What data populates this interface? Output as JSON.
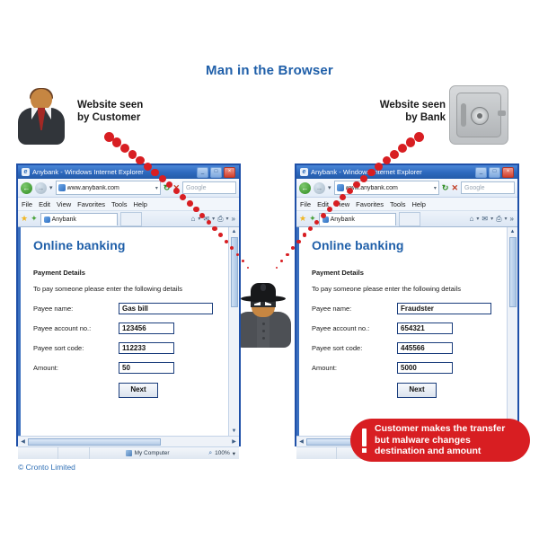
{
  "title": "Man in the Browser",
  "captions": {
    "customer": "Website seen\nby Customer",
    "customer_line1": "Website seen",
    "customer_line2": "by Customer",
    "bank_line1": "Website seen",
    "bank_line2": "by Bank"
  },
  "icons": {
    "customer": "customer-avatar-icon",
    "bank": "bank-safe-icon",
    "hacker": "hacker-icon"
  },
  "browser_chrome": {
    "window_title": "Anybank - Windows Internet Explorer",
    "minimize_label": "_",
    "maximize_label": "□",
    "close_label": "×",
    "back_label": "←",
    "forward_label": "→",
    "history_caret": "▾",
    "address": "www.anybank.com",
    "address_caret": "▾",
    "refresh_label": "↻",
    "stop_label": "✕",
    "search_placeholder": "Google",
    "menu": [
      "File",
      "Edit",
      "View",
      "Favorites",
      "Tools",
      "Help"
    ],
    "favorites_star": "★",
    "favorites_add": "✦",
    "tab_label": "Anybank",
    "toolbar_icons": [
      "⌂",
      "✉",
      "⎙"
    ],
    "toolbar_caret": "▾",
    "toolbar_chevron": "»",
    "scroll_up": "▲",
    "scroll_down": "▼",
    "scroll_left": "◀",
    "scroll_right": "▶",
    "status_zone": "My Computer",
    "status_zoom": "100%",
    "status_zoom_caret": "▾",
    "status_magnifier": "⌕"
  },
  "page": {
    "heading": "Online banking",
    "subheading": "Payment Details",
    "lead": "To pay someone please enter the following details",
    "labels": {
      "payee_name": "Payee name:",
      "payee_account": "Payee account no.:",
      "payee_sort": "Payee sort code:",
      "amount": "Amount:"
    },
    "next_button": "Next"
  },
  "customer_view": {
    "payee_name": "Gas bill",
    "payee_account": "123456",
    "payee_sort": "112233",
    "amount": "50"
  },
  "bank_view": {
    "payee_name": "Fraudster",
    "payee_account": "654321",
    "payee_sort": "445566",
    "amount": "5000"
  },
  "callout": {
    "line1": "Customer makes the transfer",
    "line2": "but malware changes",
    "line3": "destination and amount"
  },
  "footer": "© Cronto Limited",
  "colors": {
    "title_blue": "#1f5fa9",
    "accent_red": "#d81e22",
    "window_border": "#1f50a8",
    "heading_blue": "#1f5fa9",
    "footer_blue": "#2f6fb5"
  }
}
